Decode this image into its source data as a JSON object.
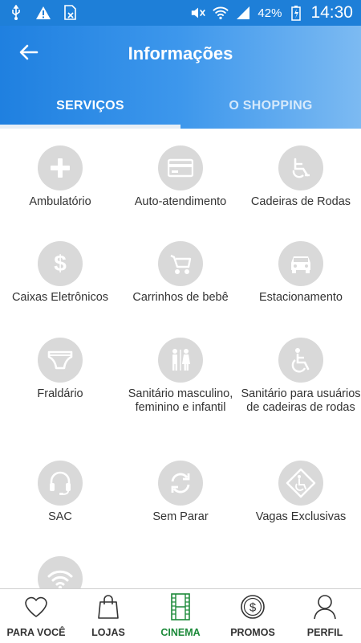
{
  "status": {
    "battery": "42%",
    "time": "14:30",
    "icons_left": [
      "usb-icon",
      "warning-icon",
      "doc-x-icon"
    ],
    "icons_right": [
      "mute-icon",
      "wifi-icon",
      "signal-icon",
      "battery-icon"
    ]
  },
  "header": {
    "title": "Informações",
    "back_icon": "arrow-left-icon"
  },
  "tabs": [
    {
      "label": "SERVIÇOS",
      "active": true
    },
    {
      "label": "O SHOPPING",
      "active": false
    }
  ],
  "services": [
    {
      "label": "Ambulatório",
      "icon": "plus-icon"
    },
    {
      "label": "Auto-atendimento",
      "icon": "credit-card-icon"
    },
    {
      "label": "Cadeiras de Rodas",
      "icon": "wheelchair-icon"
    },
    {
      "label": "Caixas Eletrônicos",
      "icon": "dollar-icon"
    },
    {
      "label": "Carrinhos de bebê",
      "icon": "stroller-icon"
    },
    {
      "label": "Estacionamento",
      "icon": "car-icon"
    },
    {
      "label": "Fraldário",
      "icon": "diaper-icon"
    },
    {
      "label": "Sanitário masculino, feminino e infantil",
      "icon": "restroom-icon"
    },
    {
      "label": "Sanitário para usuários de cadeiras de rodas",
      "icon": "accessible-icon"
    },
    {
      "label": "SAC",
      "icon": "headset-icon"
    },
    {
      "label": "Sem Parar",
      "icon": "sync-icon"
    },
    {
      "label": "Vagas Exclusivas",
      "icon": "accessible-parking-icon"
    },
    {
      "label": "",
      "icon": "wifi-icon"
    }
  ],
  "bottom_nav": [
    {
      "label": "PARA VOCÊ",
      "icon": "heart-icon"
    },
    {
      "label": "LOJAS",
      "icon": "shopping-bag-icon"
    },
    {
      "label": "CINEMA",
      "icon": "film-icon",
      "active": true
    },
    {
      "label": "PROMOS",
      "icon": "coin-dollar-icon"
    },
    {
      "label": "PERFIL",
      "icon": "user-icon"
    }
  ],
  "colors": {
    "primary": "#1e7fd8",
    "active_nav": "#1d8a3a",
    "icon_circle": "#d9d9d9"
  }
}
